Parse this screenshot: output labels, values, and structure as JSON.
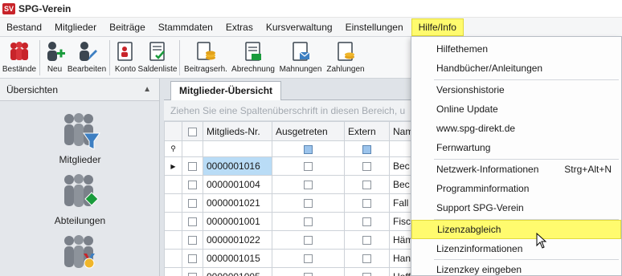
{
  "window": {
    "logo_text": "SV",
    "title": "SPG-Verein"
  },
  "menu": [
    "Bestand",
    "Mitglieder",
    "Beiträge",
    "Stammdaten",
    "Extras",
    "Kursverwaltung",
    "Einstellungen",
    "Hilfe/Info"
  ],
  "toolbar": {
    "bestaende": "Bestände",
    "neu": "Neu",
    "bearbeiten": "Bearbeiten",
    "konto": "Konto",
    "saldenliste": "Saldenliste",
    "beitragserh": "Beitragserh.",
    "abrechnung": "Abrechnung",
    "mahnungen": "Mahnungen",
    "zahlungen": "Zahlungen"
  },
  "left_panel": {
    "header": "Übersichten",
    "collapse_icon": "chevron-up",
    "items": [
      "Mitglieder",
      "Abteilungen"
    ]
  },
  "main": {
    "tab": "Mitglieder-Übersicht",
    "group_hint": "Ziehen Sie eine Spaltenüberschrift in diesen Bereich, u",
    "columns": [
      "Mitglieds-Nr.",
      "Ausgetreten",
      "Extern",
      "Nam"
    ],
    "rows": [
      {
        "nr": "0000001016",
        "name": "Bec"
      },
      {
        "nr": "0000001004",
        "name": "Bec"
      },
      {
        "nr": "0000001021",
        "name": "Fall"
      },
      {
        "nr": "0000001001",
        "name": "Fisch"
      },
      {
        "nr": "0000001022",
        "name": "Häm"
      },
      {
        "nr": "0000001015",
        "name": "Han"
      },
      {
        "nr": "0000001005",
        "name": "Hoff"
      }
    ]
  },
  "dropdown": {
    "items": [
      {
        "label": "Hilfethemen"
      },
      {
        "label": "Handbücher/Anleitungen"
      },
      {
        "label": "Versionshistorie"
      },
      {
        "label": "Online Update"
      },
      {
        "label": "www.spg-direkt.de"
      },
      {
        "label": "Fernwartung"
      },
      {
        "label": "Netzwerk-Informationen",
        "shortcut": "Strg+Alt+N"
      },
      {
        "label": "Programminformation"
      },
      {
        "label": "Support SPG-Verein"
      },
      {
        "label": "Lizenzabgleich"
      },
      {
        "label": "Lizenzinformationen"
      },
      {
        "label": "Lizenzkey eingeben"
      }
    ],
    "highlighted": "Lizenzabgleich"
  },
  "colors": {
    "highlight": "#fffb6e",
    "selected_row": "#b9dcf6",
    "accent_red": "#c8242a",
    "accent_blue": "#3d7fc2",
    "accent_green": "#1a9b3c"
  }
}
